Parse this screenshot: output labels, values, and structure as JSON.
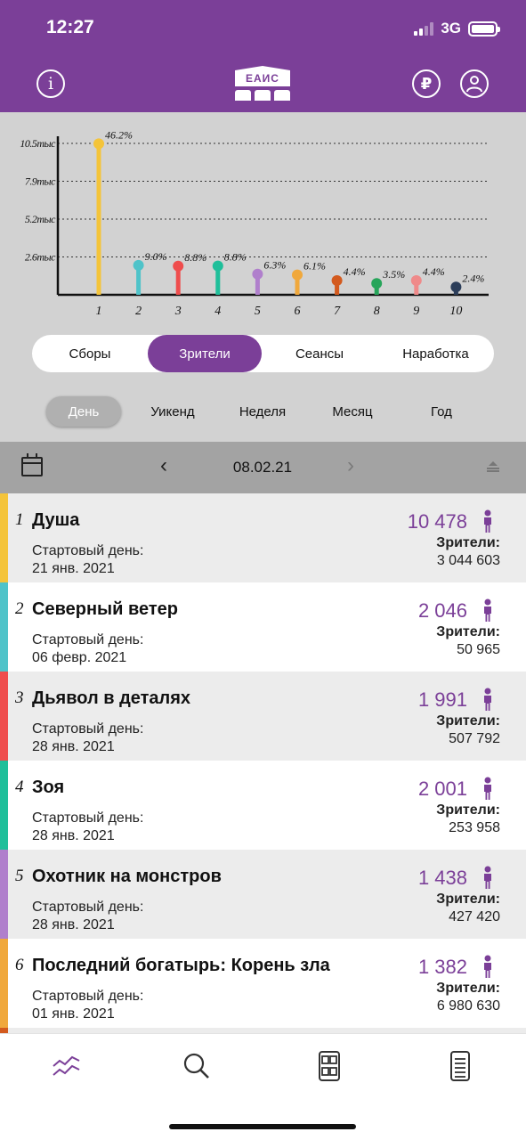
{
  "status_bar": {
    "time": "12:27",
    "network": "3G"
  },
  "header": {
    "logo_text": "ЕАИС",
    "icons": [
      "info-icon",
      "ruble-icon",
      "user-icon"
    ],
    "ruble_symbol": "₽",
    "info_symbol": "i",
    "accent_color": "#7b3f98"
  },
  "chart_data": {
    "type": "bar",
    "style": "lollipop",
    "categories": [
      "1",
      "2",
      "3",
      "4",
      "5",
      "6",
      "7",
      "8",
      "9",
      "10"
    ],
    "values": [
      10478,
      2046,
      1991,
      2001,
      1438,
      1382,
      990,
      790,
      990,
      540
    ],
    "point_labels": [
      "46.2%",
      "9.0%",
      "8.8%",
      "8.8%",
      "6.3%",
      "6.1%",
      "4.4%",
      "3.5%",
      "4.4%",
      "2.4%"
    ],
    "colors": [
      "#f4c43a",
      "#4fc3c9",
      "#ef4d4d",
      "#1fbf9a",
      "#b07fcc",
      "#f0a83c",
      "#d35a1e",
      "#27a55a",
      "#ef8a8a",
      "#2c3e5a"
    ],
    "y_ticks": [
      {
        "value": 2625,
        "label": "2.6тыс"
      },
      {
        "value": 5250,
        "label": "5.2тыс"
      },
      {
        "value": 7875,
        "label": "7.9тыс"
      },
      {
        "value": 10500,
        "label": "10.5тыс"
      }
    ],
    "ylim": [
      0,
      10500
    ],
    "grid": "dotted horizontal",
    "xlabel": "",
    "ylabel": ""
  },
  "metrics_tabs": {
    "items": [
      "Сборы",
      "Зрители",
      "Сеансы",
      "Наработка"
    ],
    "active_index": 1
  },
  "period_tabs": {
    "items": [
      "День",
      "Уикенд",
      "Неделя",
      "Месяц",
      "Год"
    ],
    "active_index": 0
  },
  "date_bar": {
    "date": "08.02.21",
    "prev_symbol": "‹",
    "next_symbol": "›"
  },
  "films": [
    {
      "rank": "1",
      "title": "Душа",
      "start_label": "Стартовый день:",
      "start_date": "21 янв. 2021",
      "count": "10 478",
      "viewers_label": "Зрители:",
      "viewers_total": "3 044 603",
      "color": "#f4c43a"
    },
    {
      "rank": "2",
      "title": "Северный ветер",
      "start_label": "Стартовый день:",
      "start_date": "06 февр. 2021",
      "count": "2 046",
      "viewers_label": "Зрители:",
      "viewers_total": "50 965",
      "color": "#4fc3c9"
    },
    {
      "rank": "3",
      "title": "Дьявол в деталях",
      "start_label": "Стартовый день:",
      "start_date": "28 янв. 2021",
      "count": "1 991",
      "viewers_label": "Зрители:",
      "viewers_total": "507 792",
      "color": "#ef4d4d"
    },
    {
      "rank": "4",
      "title": "Зоя",
      "start_label": "Стартовый день:",
      "start_date": "28 янв. 2021",
      "count": "2 001",
      "viewers_label": "Зрители:",
      "viewers_total": "253 958",
      "color": "#1fbf9a"
    },
    {
      "rank": "5",
      "title": "Охотник на монстров",
      "start_label": "Стартовый день:",
      "start_date": "28 янв. 2021",
      "count": "1 438",
      "viewers_label": "Зрители:",
      "viewers_total": "427 420",
      "color": "#b07fcc"
    },
    {
      "rank": "6",
      "title": "Последний богатырь: Корень зла",
      "start_label": "Стартовый день:",
      "start_date": "01 янв. 2021",
      "count": "1 382",
      "viewers_label": "Зрители:",
      "viewers_total": "6 980 630",
      "color": "#f0a83c"
    }
  ],
  "next_film_color": "#d35a1e",
  "tab_bar": {
    "items": [
      "chart-trend-icon",
      "search-icon",
      "cinema-list-icon",
      "document-icon"
    ],
    "active_index": 0
  }
}
